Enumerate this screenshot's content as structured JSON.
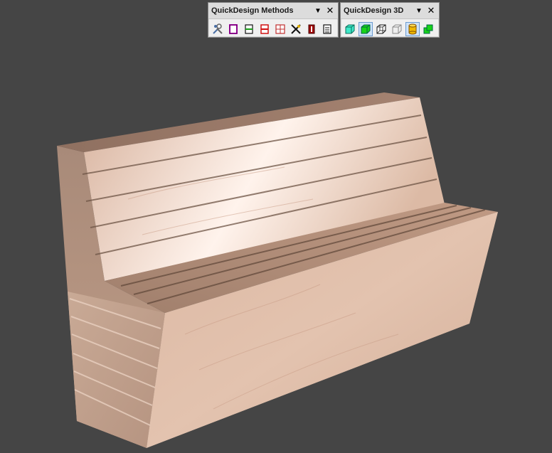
{
  "viewport": {
    "background": "#454545",
    "scene": "wooden-bench-3d-model"
  },
  "toolbars": [
    {
      "title": "QuickDesign Methods",
      "buttons": [
        {
          "icon": "tools-icon"
        },
        {
          "icon": "frame-magenta-icon"
        },
        {
          "icon": "horizontal-divide-icon"
        },
        {
          "icon": "horizontal-divide-red-icon"
        },
        {
          "icon": "grid-divide-icon"
        },
        {
          "icon": "pin-cross-icon"
        },
        {
          "icon": "vertical-panel-icon"
        },
        {
          "icon": "drawer-icon"
        }
      ]
    },
    {
      "title": "QuickDesign 3D",
      "buttons": [
        {
          "icon": "cyan-box-icon"
        },
        {
          "icon": "green-box-icon",
          "active": true
        },
        {
          "icon": "wireframe-box-icon"
        },
        {
          "icon": "hidden-line-box-icon"
        },
        {
          "icon": "cylinder-icon",
          "active": true
        },
        {
          "icon": "stacked-boxes-icon"
        }
      ]
    }
  ],
  "colors": {
    "accent": "#6d9bd1",
    "wood": "#d9b49c"
  }
}
